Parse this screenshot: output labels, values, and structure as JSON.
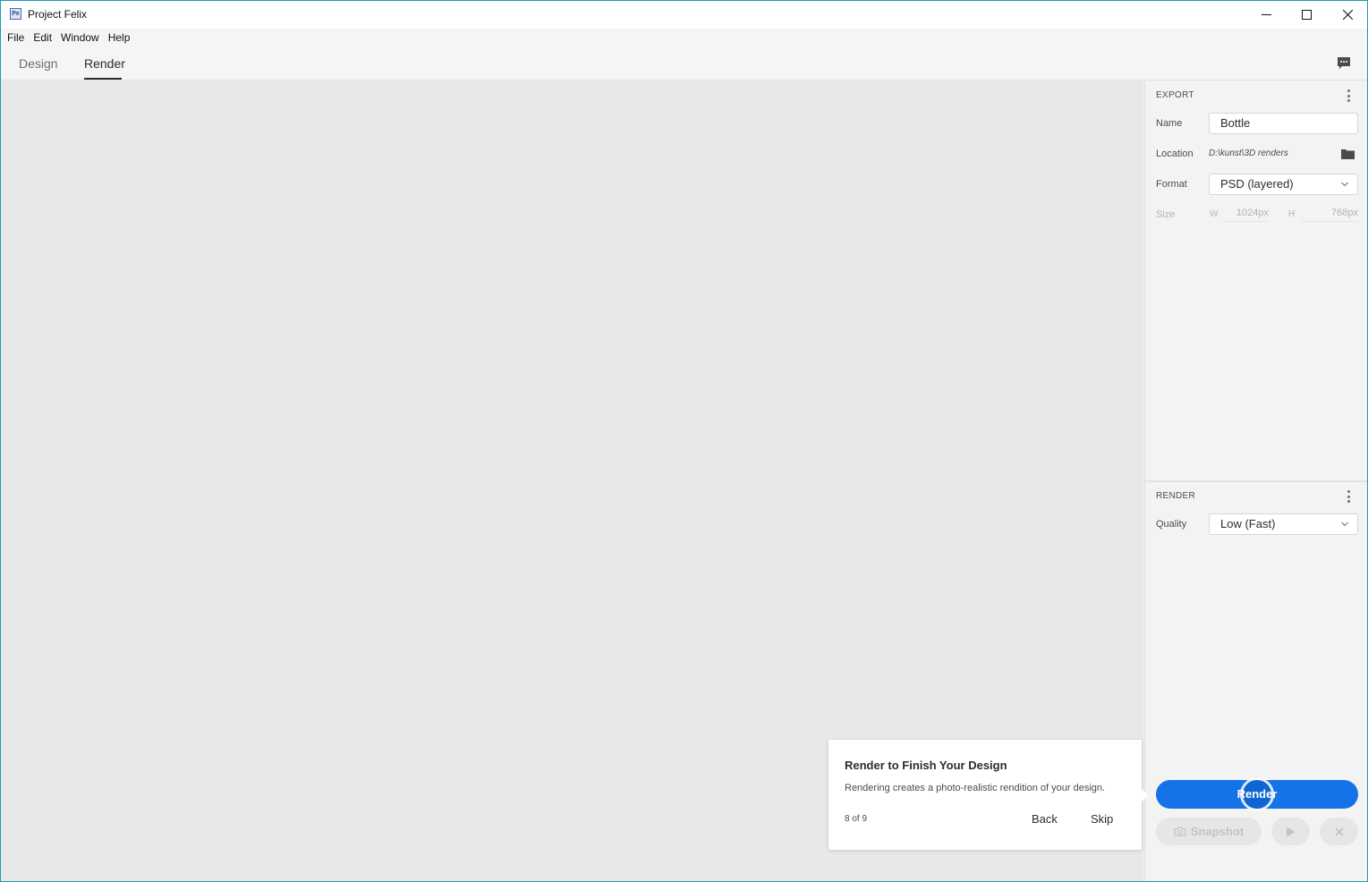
{
  "window": {
    "title": "Project Felix",
    "app_icon_text": "Pe",
    "accent_border_color": "#1f9bb6"
  },
  "menu": [
    "File",
    "Edit",
    "Window",
    "Help"
  ],
  "tabs": [
    {
      "label": "Design",
      "active": false
    },
    {
      "label": "Render",
      "active": true
    }
  ],
  "panel": {
    "export": {
      "title": "EXPORT",
      "name_label": "Name",
      "name_value": "Bottle",
      "location_label": "Location",
      "location_value": "D:\\kunst\\3D renders",
      "format_label": "Format",
      "format_value": "PSD (layered)",
      "size_label": "Size",
      "width_label": "W",
      "width_value": "1024px",
      "height_label": "H",
      "height_value": "768px"
    },
    "render": {
      "title": "RENDER",
      "quality_label": "Quality",
      "quality_value": "Low (Fast)",
      "render_button": "Render",
      "snapshot_button": "Snapshot"
    },
    "accent_color": "#1473e6"
  },
  "coach_mark": {
    "title": "Render to Finish Your Design",
    "description": "Rendering creates a photo-realistic rendition of your design.",
    "step": "8 of 9",
    "back": "Back",
    "skip": "Skip"
  },
  "icons": {
    "minimize": "minimize-icon",
    "maximize": "maximize-icon",
    "close": "close-icon",
    "comment": "comment-icon",
    "more": "more-vertical-icon",
    "folder": "folder-icon",
    "chevron": "chevron-down-icon",
    "camera": "camera-icon",
    "play": "play-icon",
    "cancel": "cancel-icon"
  }
}
